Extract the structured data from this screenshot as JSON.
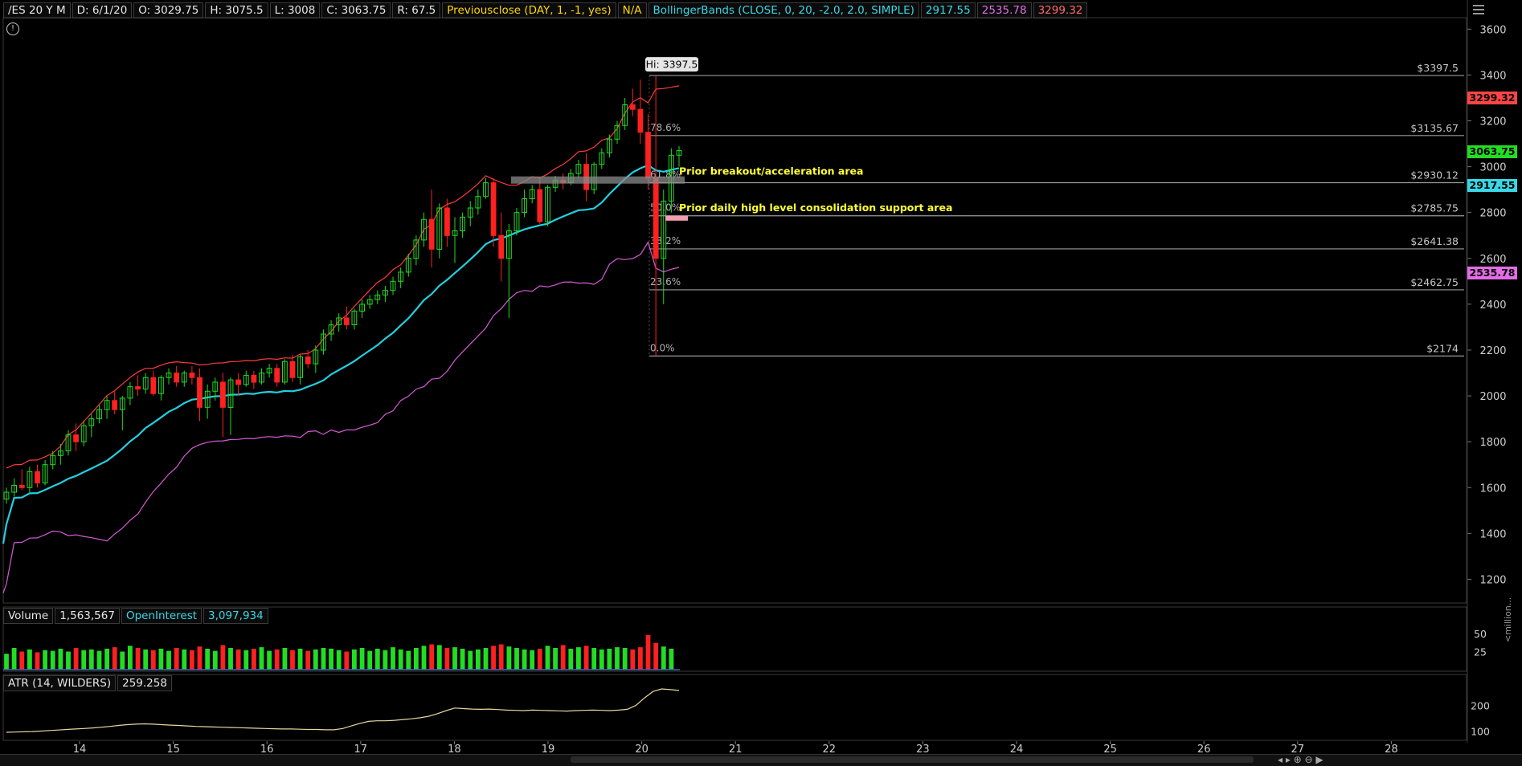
{
  "header": {
    "symbol": "/ES 20 Y M",
    "date": "D: 6/1/20",
    "open": "O: 3029.75",
    "high": "H: 3075.5",
    "low": "L: 3008",
    "close": "C: 3063.75",
    "range": "R: 67.5",
    "prevclose_study": "Previousclose (DAY, 1, -1, yes)",
    "prevclose_val": "N/A",
    "bb_study": "BollingerBands (CLOSE, 0, 20, -2.0, 2.0, SIMPLE)",
    "bb_mid": "2917.55",
    "bb_lower": "2535.78",
    "bb_upper": "3299.32"
  },
  "price_axis": {
    "ticks": [
      "3600",
      "3400",
      "3200",
      "3000",
      "2800",
      "2600",
      "2400",
      "2200",
      "2000",
      "1800",
      "1600",
      "1400",
      "1200"
    ],
    "price_labels": [
      {
        "text": "3299.32",
        "value": 3299.32,
        "color": "#ff4444",
        "textColor": "#000"
      },
      {
        "text": "3063.75",
        "value": 3063.75,
        "color": "#22dd22",
        "textColor": "#000"
      },
      {
        "text": "2917.55",
        "value": 2917.55,
        "color": "#3ad7e6",
        "textColor": "#000"
      },
      {
        "text": "2535.78",
        "value": 2535.78,
        "color": "#e36ce6",
        "textColor": "#000"
      }
    ]
  },
  "fib": {
    "hi_label": "Hi: 3397.5",
    "levels": [
      {
        "pct": "",
        "price": "$3397.5",
        "value": 3397.5
      },
      {
        "pct": "78.6%",
        "price": "$3135.67",
        "value": 3135.67
      },
      {
        "pct": "61.8%",
        "price": "$2930.12",
        "value": 2930.12
      },
      {
        "pct": "50.0%",
        "price": "$2785.75",
        "value": 2785.75
      },
      {
        "pct": "38.2%",
        "price": "$2641.38",
        "value": 2641.38
      },
      {
        "pct": "23.6%",
        "price": "$2462.75",
        "value": 2462.75
      },
      {
        "pct": "0.0%",
        "price": "$2174",
        "value": 2174
      }
    ]
  },
  "annotations": {
    "breakout": "Prior breakout/acceleration area",
    "consolidation": "Prior daily high level consolidation support area"
  },
  "volume": {
    "label": "Volume",
    "value": "1,563,567",
    "oi_label": "OpenInterest",
    "oi_value": "3,097,934",
    "ticks": [
      "50",
      "25"
    ],
    "unit": "<million..."
  },
  "atr": {
    "label": "ATR (14, WILDERS)",
    "value": "259.258",
    "ticks": [
      "200",
      "100"
    ]
  },
  "time_axis": {
    "labels": [
      "14",
      "15",
      "16",
      "17",
      "18",
      "19",
      "20",
      "21",
      "22",
      "23",
      "24",
      "25",
      "26",
      "27",
      "28"
    ]
  },
  "colors": {
    "up": "#22dd22",
    "down": "#ff2020",
    "bb_mid": "#22d0e0",
    "bb_upper": "#ff3b3b",
    "bb_lower": "#d65bd6",
    "atr": "#e8d6a0",
    "fib": "#9a9a9a"
  },
  "chart_data": {
    "type": "candlestick",
    "x_categories": [
      "14",
      "15",
      "16",
      "17",
      "18",
      "19",
      "20",
      "21",
      "22",
      "23",
      "24",
      "25",
      "26",
      "27",
      "28"
    ],
    "y_range": [
      1100,
      3650
    ],
    "candles_ohlc": [
      [
        1550,
        1600,
        1530,
        1580
      ],
      [
        1580,
        1640,
        1560,
        1610
      ],
      [
        1610,
        1680,
        1590,
        1600
      ],
      [
        1600,
        1690,
        1580,
        1670
      ],
      [
        1670,
        1700,
        1600,
        1620
      ],
      [
        1620,
        1720,
        1610,
        1700
      ],
      [
        1700,
        1760,
        1680,
        1740
      ],
      [
        1740,
        1790,
        1700,
        1760
      ],
      [
        1760,
        1850,
        1740,
        1830
      ],
      [
        1830,
        1880,
        1760,
        1800
      ],
      [
        1800,
        1890,
        1780,
        1870
      ],
      [
        1870,
        1920,
        1820,
        1900
      ],
      [
        1900,
        1960,
        1880,
        1940
      ],
      [
        1940,
        2000,
        1900,
        1980
      ],
      [
        1980,
        2020,
        1920,
        1940
      ],
      [
        1940,
        2000,
        1850,
        1990
      ],
      [
        1990,
        2060,
        1960,
        2040
      ],
      [
        2040,
        2090,
        2000,
        2030
      ],
      [
        2030,
        2100,
        2010,
        2080
      ],
      [
        2080,
        2110,
        2000,
        2010
      ],
      [
        2010,
        2090,
        1980,
        2080
      ],
      [
        2080,
        2120,
        2050,
        2100
      ],
      [
        2100,
        2130,
        2040,
        2060
      ],
      [
        2060,
        2110,
        2040,
        2100
      ],
      [
        2100,
        2130,
        2050,
        2080
      ],
      [
        2080,
        2120,
        1890,
        1950
      ],
      [
        1950,
        2050,
        1900,
        2020
      ],
      [
        2020,
        2080,
        1980,
        2060
      ],
      [
        2060,
        2100,
        1820,
        1950
      ],
      [
        1950,
        2080,
        1830,
        2070
      ],
      [
        2070,
        2100,
        2000,
        2050
      ],
      [
        2050,
        2110,
        2040,
        2090
      ],
      [
        2090,
        2110,
        2030,
        2060
      ],
      [
        2060,
        2120,
        2050,
        2100
      ],
      [
        2100,
        2140,
        2080,
        2120
      ],
      [
        2120,
        2140,
        2040,
        2060
      ],
      [
        2060,
        2160,
        2050,
        2150
      ],
      [
        2150,
        2180,
        2060,
        2080
      ],
      [
        2080,
        2180,
        2050,
        2170
      ],
      [
        2170,
        2200,
        2120,
        2140
      ],
      [
        2140,
        2220,
        2100,
        2200
      ],
      [
        2200,
        2290,
        2180,
        2270
      ],
      [
        2270,
        2330,
        2240,
        2310
      ],
      [
        2310,
        2360,
        2280,
        2340
      ],
      [
        2340,
        2390,
        2290,
        2310
      ],
      [
        2310,
        2380,
        2290,
        2370
      ],
      [
        2370,
        2420,
        2340,
        2400
      ],
      [
        2400,
        2440,
        2380,
        2420
      ],
      [
        2420,
        2460,
        2400,
        2440
      ],
      [
        2440,
        2480,
        2410,
        2460
      ],
      [
        2460,
        2520,
        2440,
        2500
      ],
      [
        2500,
        2560,
        2470,
        2540
      ],
      [
        2540,
        2620,
        2520,
        2600
      ],
      [
        2600,
        2700,
        2570,
        2680
      ],
      [
        2680,
        2800,
        2650,
        2770
      ],
      [
        2770,
        2900,
        2560,
        2640
      ],
      [
        2640,
        2840,
        2600,
        2820
      ],
      [
        2820,
        2860,
        2650,
        2700
      ],
      [
        2700,
        2780,
        2580,
        2720
      ],
      [
        2720,
        2800,
        2690,
        2780
      ],
      [
        2780,
        2850,
        2740,
        2820
      ],
      [
        2820,
        2900,
        2790,
        2870
      ],
      [
        2870,
        2950,
        2860,
        2930
      ],
      [
        2930,
        2950,
        2650,
        2700
      ],
      [
        2700,
        2800,
        2500,
        2600
      ],
      [
        2600,
        2750,
        2340,
        2720
      ],
      [
        2720,
        2820,
        2700,
        2800
      ],
      [
        2800,
        2900,
        2780,
        2860
      ],
      [
        2860,
        2920,
        2840,
        2900
      ],
      [
        2900,
        2950,
        2750,
        2760
      ],
      [
        2760,
        2920,
        2740,
        2910
      ],
      [
        2910,
        2960,
        2890,
        2940
      ],
      [
        2940,
        2970,
        2900,
        2930
      ],
      [
        2930,
        2990,
        2920,
        2970
      ],
      [
        2970,
        3030,
        2950,
        3010
      ],
      [
        3010,
        3060,
        2850,
        2900
      ],
      [
        2900,
        3020,
        2880,
        3010
      ],
      [
        3010,
        3080,
        2990,
        3060
      ],
      [
        3060,
        3140,
        3040,
        3120
      ],
      [
        3120,
        3200,
        3100,
        3180
      ],
      [
        3180,
        3300,
        3160,
        3270
      ],
      [
        3270,
        3340,
        3220,
        3250
      ],
      [
        3250,
        3380,
        3100,
        3150
      ],
      [
        3150,
        3230,
        2900,
        2950
      ],
      [
        2950,
        3397.5,
        2174,
        2600
      ],
      [
        2600,
        2900,
        2400,
        2850
      ],
      [
        2850,
        3080,
        2800,
        3050
      ],
      [
        3050,
        3090,
        3000,
        3070
      ]
    ],
    "volume_millions": [
      22,
      30,
      25,
      28,
      24,
      27,
      26,
      29,
      25,
      30,
      27,
      28,
      26,
      29,
      31,
      25,
      33,
      30,
      28,
      27,
      29,
      26,
      30,
      28,
      27,
      32,
      29,
      26,
      34,
      30,
      28,
      27,
      29,
      31,
      26,
      28,
      30,
      27,
      29,
      26,
      28,
      30,
      29,
      27,
      25,
      28,
      30,
      26,
      29,
      27,
      31,
      28,
      26,
      30,
      33,
      35,
      34,
      30,
      31,
      29,
      26,
      28,
      30,
      33,
      35,
      32,
      30,
      28,
      27,
      29,
      33,
      30,
      34,
      29,
      31,
      33,
      30,
      28,
      29,
      31,
      30,
      28,
      31,
      48,
      37,
      32,
      29
    ],
    "atr_values": [
      95,
      96,
      97,
      98,
      100,
      102,
      104,
      106,
      108,
      110,
      112,
      115,
      118,
      122,
      125,
      127,
      128,
      127,
      125,
      123,
      122,
      120,
      118,
      117,
      116,
      115,
      114,
      113,
      112,
      111,
      110,
      109,
      108,
      108,
      107,
      106,
      106,
      105,
      105,
      110,
      120,
      130,
      138,
      140,
      140,
      142,
      145,
      148,
      152,
      158,
      168,
      180,
      190,
      188,
      186,
      185,
      186,
      184,
      182,
      181,
      180,
      182,
      181,
      180,
      179,
      178,
      180,
      181,
      182,
      181,
      180,
      182,
      185,
      200,
      230,
      255,
      265,
      262,
      259
    ]
  }
}
